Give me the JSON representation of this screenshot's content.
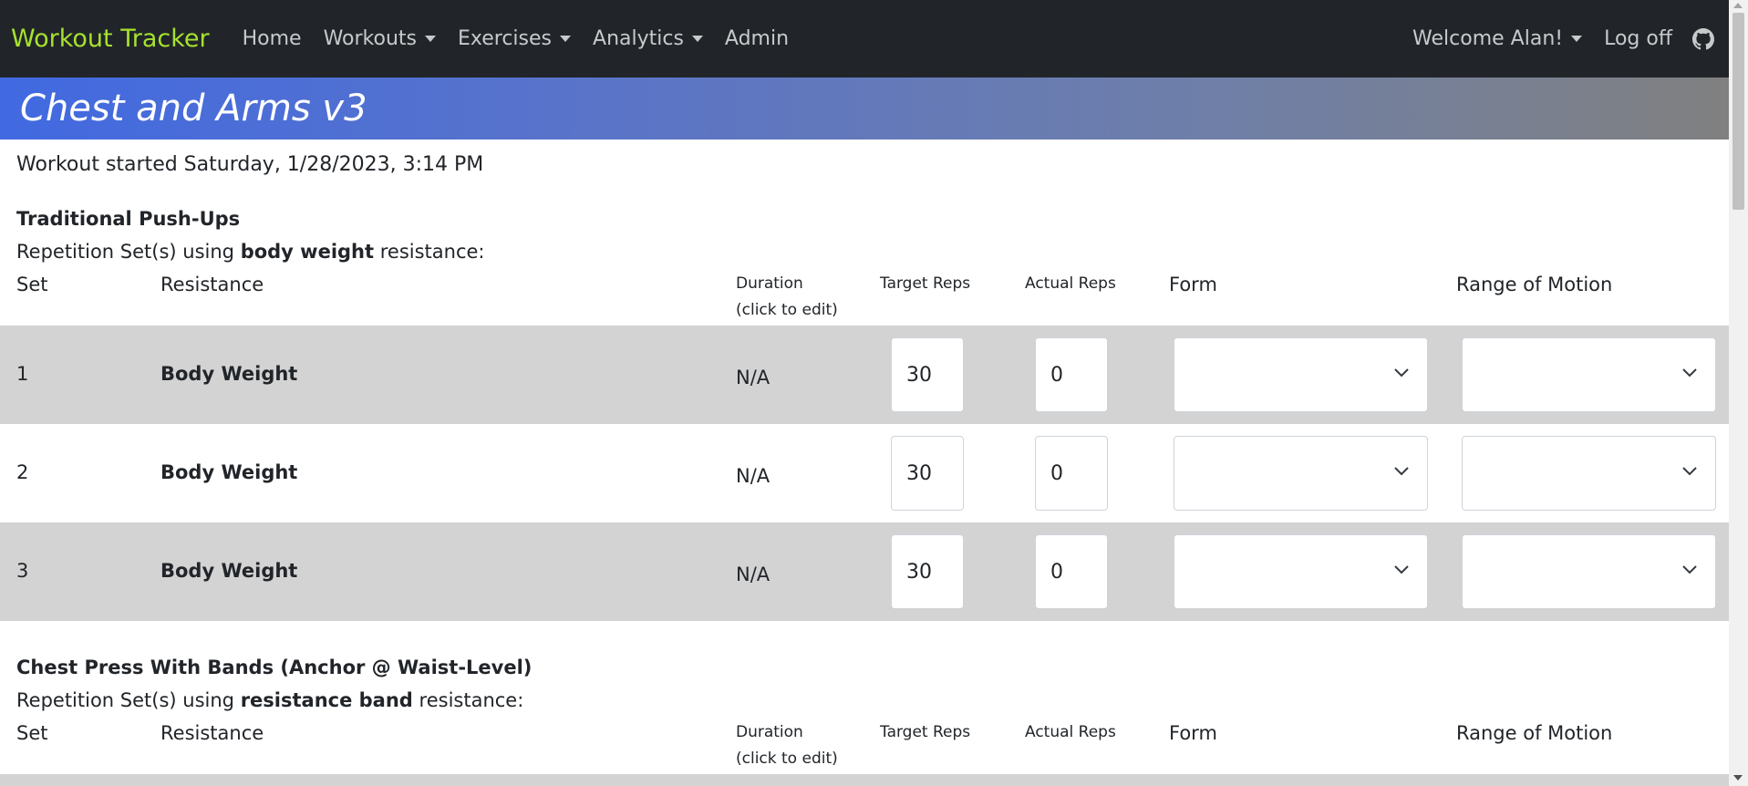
{
  "navbar": {
    "brand": "Workout Tracker",
    "items": [
      "Home",
      "Workouts",
      "Exercises",
      "Analytics",
      "Admin"
    ],
    "welcome": "Welcome Alan!",
    "logoff": "Log off",
    "brand_color": "#a6e22e"
  },
  "banner": {
    "title": "Chest and Arms v3"
  },
  "workout_started": "Workout started Saturday, 1/28/2023, 3:14 PM",
  "columns": {
    "set": "Set",
    "resistance": "Resistance",
    "duration": "Duration (click to edit)",
    "target": "Target Reps",
    "actual": "Actual Reps",
    "form": "Form",
    "rom": "Range of Motion"
  },
  "exercises": [
    {
      "name": "Traditional Push-Ups",
      "desc_prefix": "Repetition Set(s) using",
      "desc_type": "body weight",
      "desc_suffix": "resistance:",
      "sets": [
        {
          "set": "1",
          "resistance": "Body Weight",
          "duration": "N/A",
          "target": "30",
          "actual": "0",
          "form": "",
          "rom": ""
        },
        {
          "set": "2",
          "resistance": "Body Weight",
          "duration": "N/A",
          "target": "30",
          "actual": "0",
          "form": "",
          "rom": ""
        },
        {
          "set": "3",
          "resistance": "Body Weight",
          "duration": "N/A",
          "target": "30",
          "actual": "0",
          "form": "",
          "rom": ""
        }
      ]
    },
    {
      "name": "Chest Press With Bands (Anchor @ Waist-Level)",
      "desc_prefix": "Repetition Set(s) using",
      "desc_type": "resistance band",
      "desc_suffix": "resistance:",
      "sets": []
    }
  ],
  "icons": {
    "caret": "caret-down-icon",
    "github": "github-icon",
    "select_chevron": "chevron-down-icon"
  }
}
